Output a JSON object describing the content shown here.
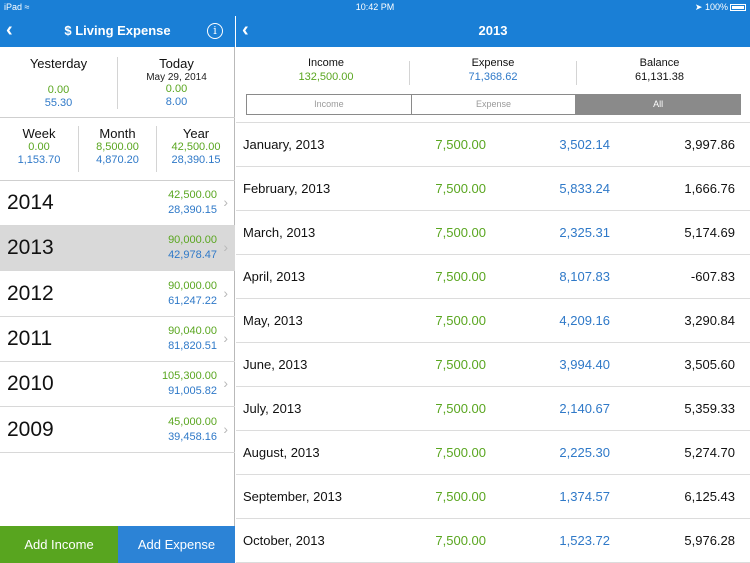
{
  "status": {
    "device": "iPad",
    "time": "10:42 PM",
    "battery": "100%"
  },
  "left": {
    "title": "$ Living Expense",
    "back_icon": "chevron-left-icon",
    "info_icon": "info-icon",
    "yesterday": {
      "label": "Yesterday",
      "income": "0.00",
      "expense": "55.30"
    },
    "today": {
      "label": "Today",
      "date": "May 29, 2014",
      "income": "0.00",
      "expense": "8.00"
    },
    "week": {
      "label": "Week",
      "income": "0.00",
      "expense": "1,153.70"
    },
    "month": {
      "label": "Month",
      "income": "8,500.00",
      "expense": "4,870.20"
    },
    "year": {
      "label": "Year",
      "income": "42,500.00",
      "expense": "28,390.15"
    },
    "years": [
      {
        "year": "2014",
        "income": "42,500.00",
        "expense": "28,390.15"
      },
      {
        "year": "2013",
        "income": "90,000.00",
        "expense": "42,978.47"
      },
      {
        "year": "2012",
        "income": "90,000.00",
        "expense": "61,247.22"
      },
      {
        "year": "2011",
        "income": "90,040.00",
        "expense": "81,820.51"
      },
      {
        "year": "2010",
        "income": "105,300.00",
        "expense": "91,005.82"
      },
      {
        "year": "2009",
        "income": "45,000.00",
        "expense": "39,458.16"
      }
    ],
    "selected_year": "2013",
    "add_income": "Add Income",
    "add_expense": "Add Expense"
  },
  "right": {
    "title": "2013",
    "income_label": "Income",
    "income_value": "132,500.00",
    "expense_label": "Expense",
    "expense_value": "71,368.62",
    "balance_label": "Balance",
    "balance_value": "61,131.38",
    "segments": [
      "Income",
      "Expense",
      "All"
    ],
    "selected_segment": "All",
    "months": [
      {
        "month": "January, 2013",
        "income": "7,500.00",
        "expense": "3,502.14",
        "balance": "3,997.86"
      },
      {
        "month": "February, 2013",
        "income": "7,500.00",
        "expense": "5,833.24",
        "balance": "1,666.76"
      },
      {
        "month": "March, 2013",
        "income": "7,500.00",
        "expense": "2,325.31",
        "balance": "5,174.69"
      },
      {
        "month": "April, 2013",
        "income": "7,500.00",
        "expense": "8,107.83",
        "balance": "-607.83"
      },
      {
        "month": "May, 2013",
        "income": "7,500.00",
        "expense": "4,209.16",
        "balance": "3,290.84"
      },
      {
        "month": "June, 2013",
        "income": "7,500.00",
        "expense": "3,994.40",
        "balance": "3,505.60"
      },
      {
        "month": "July, 2013",
        "income": "7,500.00",
        "expense": "2,140.67",
        "balance": "5,359.33"
      },
      {
        "month": "August, 2013",
        "income": "7,500.00",
        "expense": "2,225.30",
        "balance": "5,274.70"
      },
      {
        "month": "September, 2013",
        "income": "7,500.00",
        "expense": "1,374.57",
        "balance": "6,125.43"
      },
      {
        "month": "October, 2013",
        "income": "7,500.00",
        "expense": "1,523.72",
        "balance": "5,976.28"
      }
    ]
  },
  "colors": {
    "nav_blue": "#1a7fd6",
    "income_green": "#5aa620",
    "expense_blue": "#2f79c8",
    "add_income_bg": "#58a51f",
    "add_expense_bg": "#2c83d6"
  }
}
